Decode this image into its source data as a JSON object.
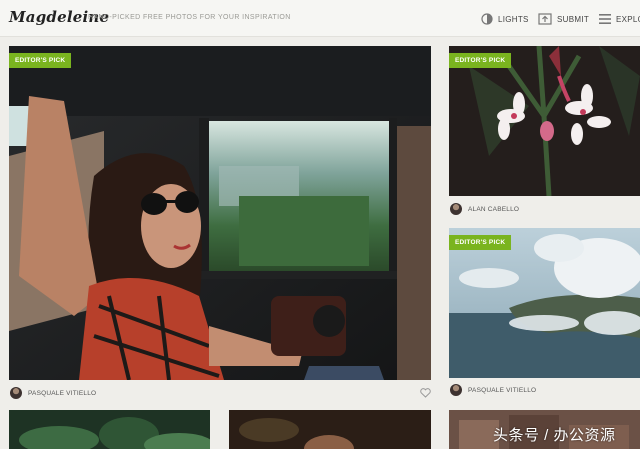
{
  "header": {
    "logo": "Magdeleine",
    "tagline": "HAND-PICKED FREE PHOTOS FOR YOUR INSPIRATION",
    "nav": {
      "lights": "LIGHTS",
      "submit": "SUBMIT",
      "explore": "EXPLO"
    }
  },
  "photos": {
    "main": {
      "badge": "EDITOR'S PICK",
      "author": "PASQUALE VITIELLO"
    },
    "flowers": {
      "badge": "EDITOR'S PICK",
      "author": "ALAN CABELLO"
    },
    "landscape": {
      "badge": "EDITOR'S PICK",
      "author": "PASQUALE VITIELLO"
    }
  },
  "watermark": "头条号 / 办公资源",
  "colors": {
    "badge_green": "#7ab41f",
    "background": "#efeeea"
  }
}
